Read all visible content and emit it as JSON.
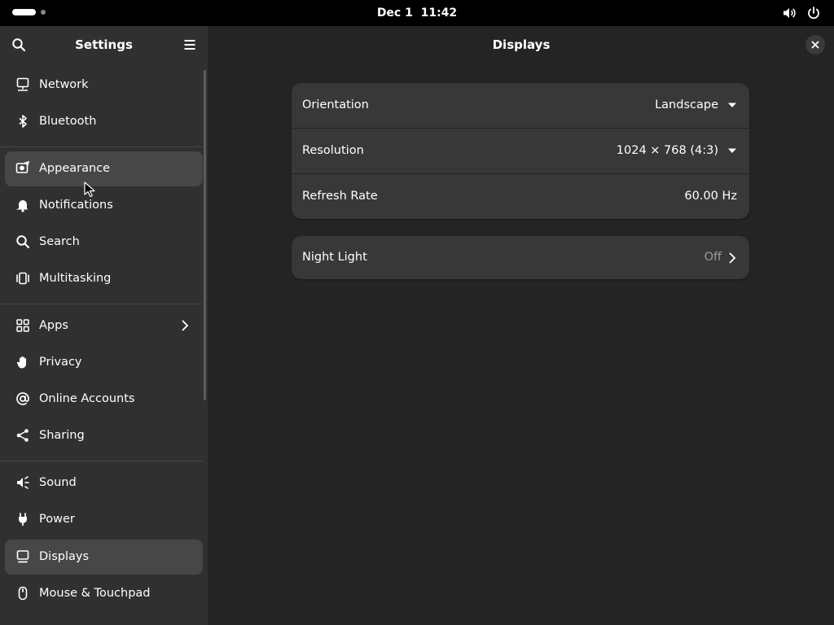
{
  "topbar": {
    "date": "Dec 1",
    "time": "11:42",
    "icons": [
      "volume-icon",
      "power-icon"
    ]
  },
  "sidebar": {
    "title": "Settings",
    "items": [
      {
        "label": "Network",
        "icon": "network-icon"
      },
      {
        "label": "Bluetooth",
        "icon": "bluetooth-icon"
      },
      {
        "label": "Appearance",
        "icon": "appearance-icon"
      },
      {
        "label": "Notifications",
        "icon": "bell-icon"
      },
      {
        "label": "Search",
        "icon": "search-icon"
      },
      {
        "label": "Multitasking",
        "icon": "multitasking-icon"
      },
      {
        "label": "Apps",
        "icon": "apps-grid-icon"
      },
      {
        "label": "Privacy",
        "icon": "hand-icon"
      },
      {
        "label": "Online Accounts",
        "icon": "at-icon"
      },
      {
        "label": "Sharing",
        "icon": "share-icon"
      },
      {
        "label": "Sound",
        "icon": "speaker-icon"
      },
      {
        "label": "Power",
        "icon": "plug-icon"
      },
      {
        "label": "Displays",
        "icon": "monitor-icon"
      },
      {
        "label": "Mouse & Touchpad",
        "icon": "mouse-icon"
      }
    ],
    "hovered": "Appearance",
    "selected": "Displays"
  },
  "main": {
    "title": "Displays",
    "display_settings": {
      "orientation": {
        "label": "Orientation",
        "value": "Landscape"
      },
      "resolution": {
        "label": "Resolution",
        "value": "1024 × 768 (4:3)"
      },
      "refresh_rate": {
        "label": "Refresh Rate",
        "value": "60.00 Hz"
      }
    },
    "night_light": {
      "label": "Night Light",
      "value": "Off"
    }
  },
  "colors": {
    "background": "#242424",
    "sidebar": "#303030",
    "card": "#383838",
    "row_highlight": "#474747",
    "topbar": "#000000",
    "text": "#ffffff",
    "dim_text": "#9a9a9a"
  }
}
